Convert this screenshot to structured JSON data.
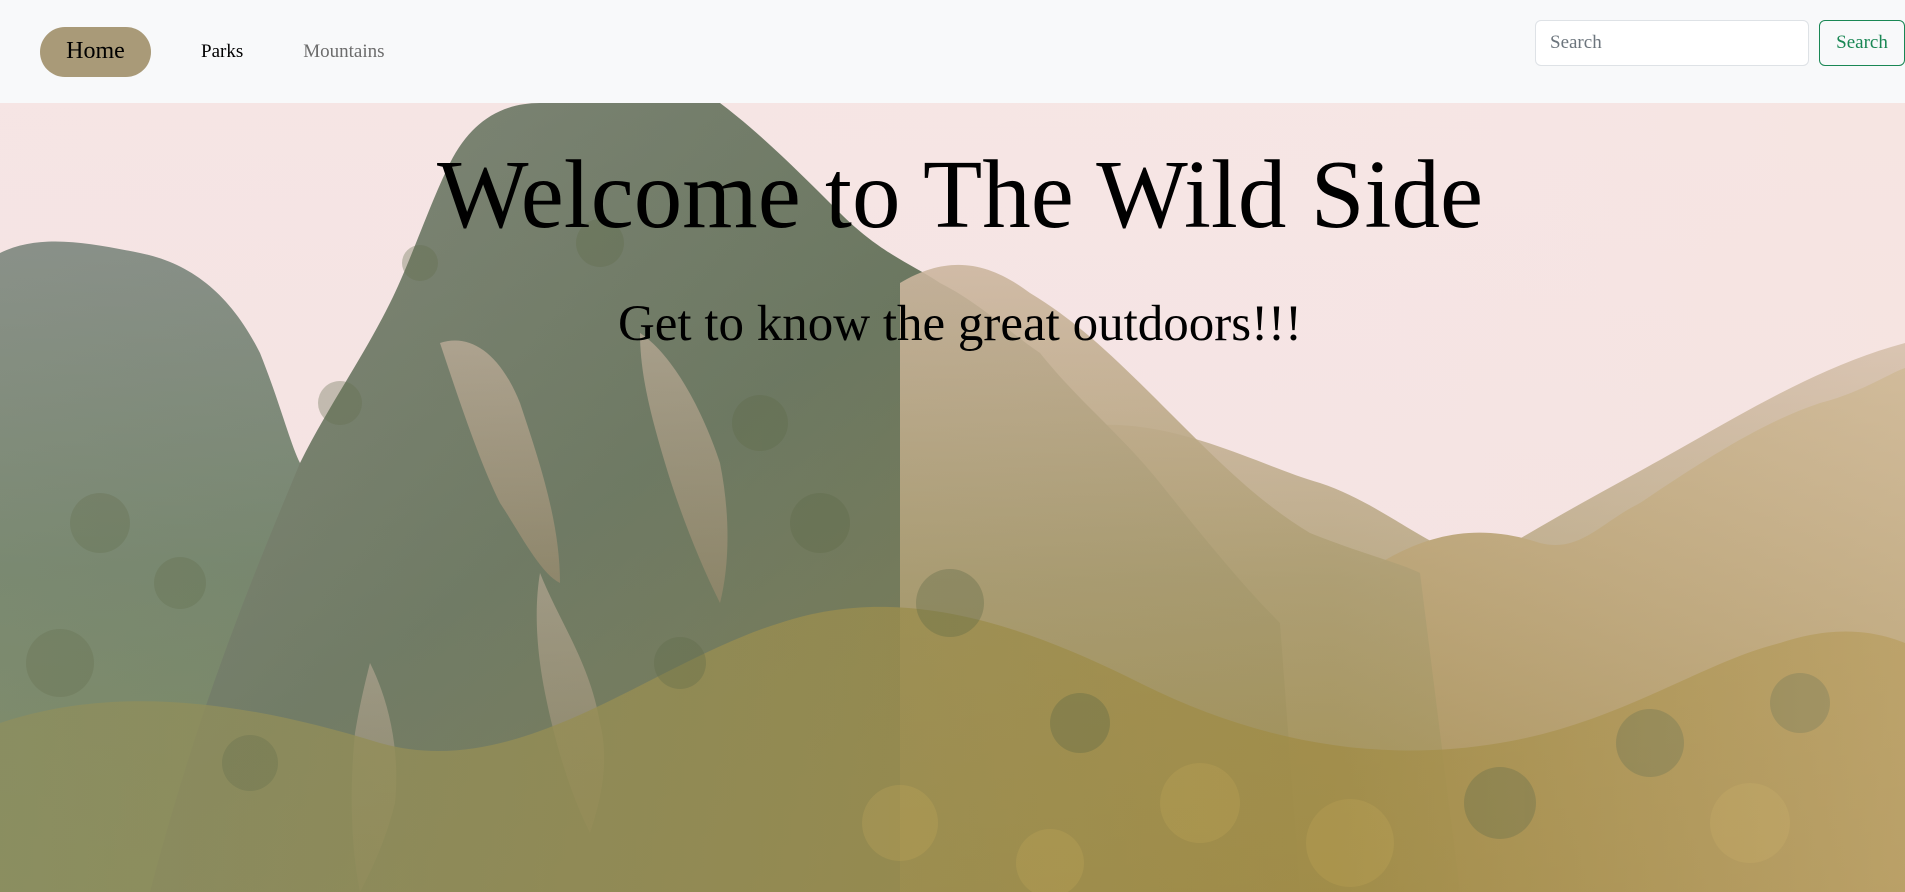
{
  "navbar": {
    "home_label": "Home",
    "links": [
      {
        "label": "Parks"
      },
      {
        "label": "Mountains"
      }
    ],
    "search": {
      "placeholder": "Search",
      "value": "",
      "button_label": "Search"
    }
  },
  "hero": {
    "title": "Welcome to The Wild Side",
    "subtitle": "Get to know the great outdoors!!!"
  },
  "colors": {
    "home_pill": "#a99a78",
    "search_button": "#198754",
    "navbar_bg": "#f8f9fa",
    "sky": "#f7e4e3"
  }
}
